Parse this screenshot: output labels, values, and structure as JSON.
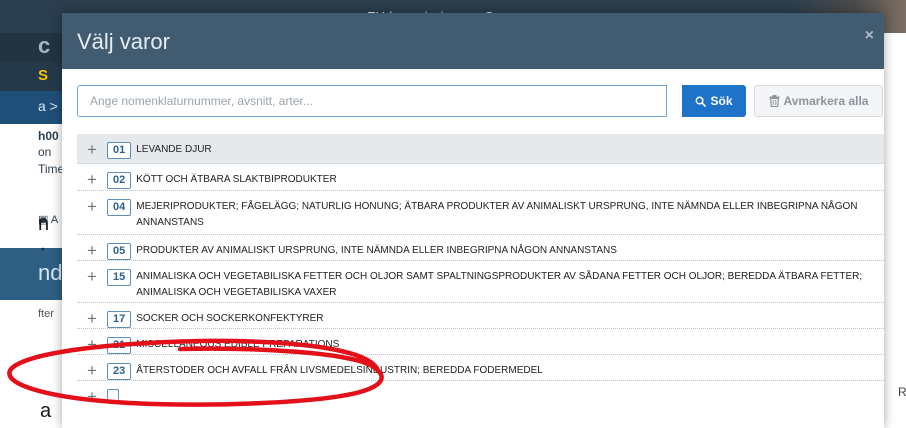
{
  "window": {
    "title": "EU-kommissionen - C"
  },
  "background": {
    "frag_bar1": "c",
    "frag_bar2": "S",
    "frag_bar3": "a >",
    "frag_h0": "h00",
    "frag_on": "on",
    "frag_time": "Time",
    "frag_a": "▣ A",
    "frag_n": "n",
    "frag_dot": ".",
    "frag_nd": "nd",
    "frag_fter": "fter",
    "frag_a2": "a",
    "frag_r": "R-"
  },
  "modal": {
    "title": "Välj varor",
    "close_label": "×",
    "search": {
      "placeholder": "Ange nomenklaturnummer, avsnitt, arter...",
      "value": "",
      "search_label": "Sök",
      "clear_label": "Avmarkera alla"
    },
    "rows": [
      {
        "code": "01",
        "label": "LEVANDE DJUR"
      },
      {
        "code": "02",
        "label": "KÖTT OCH ÄTBARA SLAKTBIPRODUKTER"
      },
      {
        "code": "04",
        "label": "MEJERIPRODUKTER; FÅGELÄGG; NATURLIG HONUNG; ÄTBARA PRODUKTER AV ANIMALISKT URSPRUNG, INTE NÄMNDA ELLER INBEGRIPNA NÅGON ANNANSTANS"
      },
      {
        "code": "05",
        "label": "PRODUKTER AV ANIMALISKT URSPRUNG, INTE NÄMNDA ELLER INBEGRIPNA NÅGON ANNANSTANS"
      },
      {
        "code": "15",
        "label": "ANIMALISKA OCH VEGETABILISKA FETTER OCH OLJOR SAMT SPALTNINGSPRODUKTER AV SÅDANA FETTER OCH OLJOR; BEREDDA ÄTBARA FETTER; ANIMALISKA OCH VEGETABILISKA VAXER"
      },
      {
        "code": "17",
        "label": "SOCKER OCH SOCKERKONFEKTYRER"
      },
      {
        "code": "21",
        "label": "MISCELLANEOUS EDIBLE PREPARATIONS"
      },
      {
        "code": "23",
        "label": "ÅTERSTODER OCH AVFALL FRÅN LIVSMEDELSINDUSTRIN; BEREDDA FODERMEDEL"
      }
    ],
    "expand_symbol": "+"
  },
  "colors": {
    "modal_header": "#415b71",
    "search_button": "#1e73c8",
    "annotation": "#e3101a"
  },
  "icons": {
    "search": "magnifier-icon",
    "clear": "trash-icon",
    "expand": "plus-icon",
    "close": "close-icon"
  }
}
